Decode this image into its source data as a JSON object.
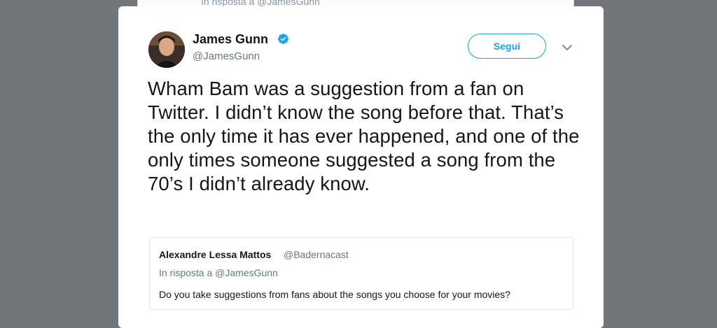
{
  "background_tweet": {
    "reply_context": "In risposta a @JamesGunn"
  },
  "tweet": {
    "author": {
      "display_name": "James Gunn",
      "handle": "@JamesGunn",
      "verified": true
    },
    "follow_label": "Segui",
    "text": "Wham Bam was a suggestion from a fan on Twitter. I didn’t know the song before that. That’s the only time it has ever happened, and one of the only times someone suggested a song from the 70’s I didn’t already know.",
    "quoted": {
      "author_name": "Alexandre Lessa Mattos",
      "author_handle": "@Badernacast",
      "reply_context": "In risposta a @JamesGunn",
      "text": "Do you take suggestions from fans about the songs you choose for your movies?"
    }
  },
  "icons": {
    "verified": "verified-badge-icon",
    "more": "chevron-down-icon"
  },
  "colors": {
    "accent": "#1da1f2",
    "overlay": "#737679",
    "text_primary": "#14171a",
    "text_secondary": "#657786"
  }
}
